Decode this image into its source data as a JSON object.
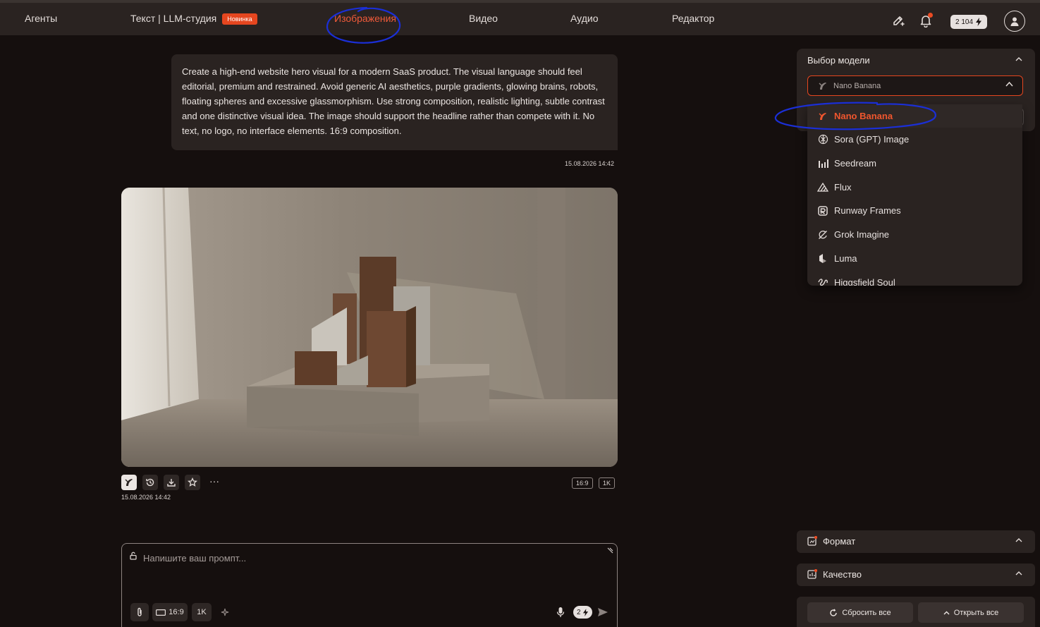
{
  "nav": {
    "agents": "Агенты",
    "text_studio": "Текст | LLM-студия",
    "new_badge": "Новинка",
    "images": "Изображения",
    "video": "Видео",
    "audio": "Аудио",
    "editor": "Редактор",
    "credits": "2 104",
    "active_color": "#ef5a3a"
  },
  "message": {
    "prompt": "Create a high-end website hero visual for a modern SaaS product. The visual language should feel editorial, premium and restrained. Avoid generic AI aesthetics, purple gradients, glowing brains, robots, floating spheres and excessive glassmorphism. Use strong composition, realistic lighting, subtle contrast and one distinctive visual idea. The image should support the headline rather than compete with it. No text, no logo, no interface elements. 16:9 composition.",
    "timestamp": "15.08.2026 14:42"
  },
  "result": {
    "timestamp": "15.08.2026 14:42",
    "more": "···",
    "tags": [
      "16:9",
      "1K"
    ]
  },
  "composer": {
    "placeholder": "Напишите ваш промпт...",
    "aspect": "16:9",
    "quality": "1K",
    "cost": "2"
  },
  "model_panel": {
    "title": "Выбор модели",
    "selected": "Nano Banana",
    "options": [
      {
        "label": "Nano Banana",
        "icon": "banana-icon"
      },
      {
        "label": "Sora (GPT) Image",
        "icon": "openai-icon"
      },
      {
        "label": "Seedream",
        "icon": "bars-icon"
      },
      {
        "label": "Flux",
        "icon": "flux-icon"
      },
      {
        "label": "Runway Frames",
        "icon": "runway-icon"
      },
      {
        "label": "Grok Imagine",
        "icon": "grok-icon"
      },
      {
        "label": "Luma",
        "icon": "luma-icon"
      },
      {
        "label": "Higgsfield Soul",
        "icon": "higgsfield-icon"
      }
    ],
    "accent": "#e5461f"
  },
  "sections": {
    "format": "Формат",
    "quality": "Качество"
  },
  "footer": {
    "reset": "Сбросить все",
    "open": "Открыть все"
  }
}
